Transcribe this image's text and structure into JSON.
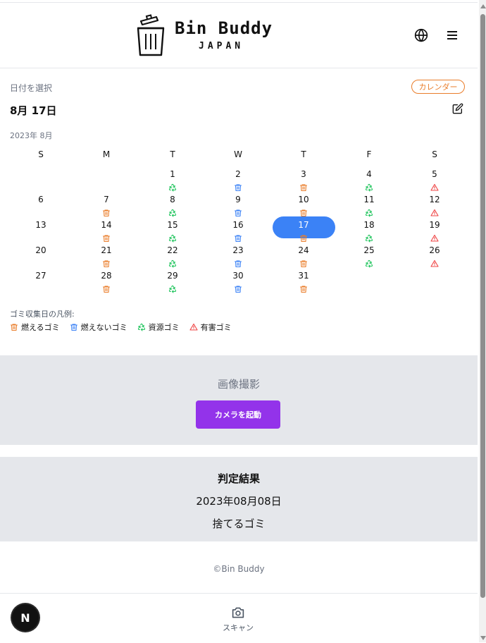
{
  "header": {
    "logo_title": "Bin Buddy",
    "logo_subtitle": "JAPAN",
    "language_icon": "globe-icon",
    "menu_icon": "hamburger-menu-icon"
  },
  "date_picker": {
    "label": "日付を選択",
    "toggle_label": "カレンダー",
    "selected_date": "8月 17日",
    "month_label": "2023年 8月"
  },
  "calendar": {
    "weekdays": [
      "S",
      "M",
      "T",
      "W",
      "T",
      "F",
      "S"
    ],
    "selected_day": "17",
    "weeks": [
      [
        null,
        null,
        {
          "day": "1",
          "type": "recycle"
        },
        {
          "day": "2",
          "type": "noncombustible"
        },
        {
          "day": "3",
          "type": "combustible"
        },
        {
          "day": "4",
          "type": "recycle"
        },
        {
          "day": "5",
          "type": "hazardous"
        }
      ],
      [
        {
          "day": "6",
          "type": null
        },
        {
          "day": "7",
          "type": "combustible"
        },
        {
          "day": "8",
          "type": "recycle"
        },
        {
          "day": "9",
          "type": "noncombustible"
        },
        {
          "day": "10",
          "type": "combustible"
        },
        {
          "day": "11",
          "type": "recycle"
        },
        {
          "day": "12",
          "type": "hazardous"
        }
      ],
      [
        {
          "day": "13",
          "type": null
        },
        {
          "day": "14",
          "type": "combustible"
        },
        {
          "day": "15",
          "type": "recycle"
        },
        {
          "day": "16",
          "type": "noncombustible"
        },
        {
          "day": "17",
          "type": "combustible"
        },
        {
          "day": "18",
          "type": "recycle"
        },
        {
          "day": "19",
          "type": "hazardous"
        }
      ],
      [
        {
          "day": "20",
          "type": null
        },
        {
          "day": "21",
          "type": "combustible"
        },
        {
          "day": "22",
          "type": "recycle"
        },
        {
          "day": "23",
          "type": "noncombustible"
        },
        {
          "day": "24",
          "type": "combustible"
        },
        {
          "day": "25",
          "type": "recycle"
        },
        {
          "day": "26",
          "type": "hazardous"
        }
      ],
      [
        {
          "day": "27",
          "type": null
        },
        {
          "day": "28",
          "type": "combustible"
        },
        {
          "day": "29",
          "type": "recycle"
        },
        {
          "day": "30",
          "type": "noncombustible"
        },
        {
          "day": "31",
          "type": "combustible"
        },
        null,
        null
      ]
    ]
  },
  "legend": {
    "title": "ゴミ収集日の凡例:",
    "items": [
      {
        "type": "combustible",
        "label": "燃えるゴミ",
        "icon": "trash-icon",
        "color": "#ea7d2a"
      },
      {
        "type": "noncombustible",
        "label": "燃えないゴミ",
        "icon": "trash-icon",
        "color": "#3b82f6"
      },
      {
        "type": "recycle",
        "label": "資源ゴミ",
        "icon": "recycle-icon",
        "color": "#22c55e"
      },
      {
        "type": "hazardous",
        "label": "有害ゴミ",
        "icon": "warning-icon",
        "color": "#ef4444"
      }
    ]
  },
  "capture": {
    "title": "画像撮影",
    "button_label": "カメラを起動"
  },
  "result": {
    "title": "判定結果",
    "date": "2023年08月08日",
    "type": "捨てるゴミ"
  },
  "footer": {
    "copyright": "©Bin Buddy"
  },
  "bottom_nav": {
    "scan_label": "スキャン",
    "scan_icon": "camera-icon"
  },
  "badge": {
    "label": "N"
  },
  "colors": {
    "accent_orange": "#ea7d2a",
    "selected_blue": "#3b82f6",
    "camera_purple": "#9333ea",
    "section_gray": "#e5e7eb"
  }
}
